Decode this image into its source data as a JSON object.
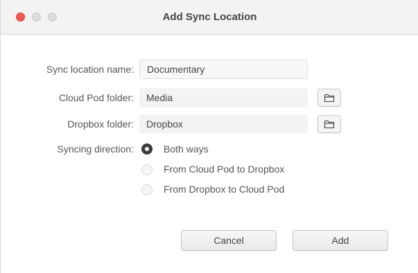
{
  "window": {
    "title": "Add Sync Location",
    "controls": [
      "close",
      "minimize",
      "zoom"
    ],
    "colors": {
      "close": "#ee5b57",
      "inactive": "#dcdcdc"
    }
  },
  "form": {
    "name_label": "Sync location name:",
    "name_value": "Documentary",
    "cloud_label": "Cloud Pod folder:",
    "cloud_value": "Media",
    "dropbox_label": "Dropbox folder:",
    "dropbox_value": "Dropbox",
    "direction_label": "Syncing direction:",
    "direction_options": [
      {
        "label": "Both ways",
        "selected": true
      },
      {
        "label": "From Cloud Pod to Dropbox",
        "selected": false
      },
      {
        "label": "From Dropbox to Cloud Pod",
        "selected": false
      }
    ],
    "folder_icon": "folder-icon"
  },
  "buttons": {
    "cancel": "Cancel",
    "add": "Add"
  }
}
